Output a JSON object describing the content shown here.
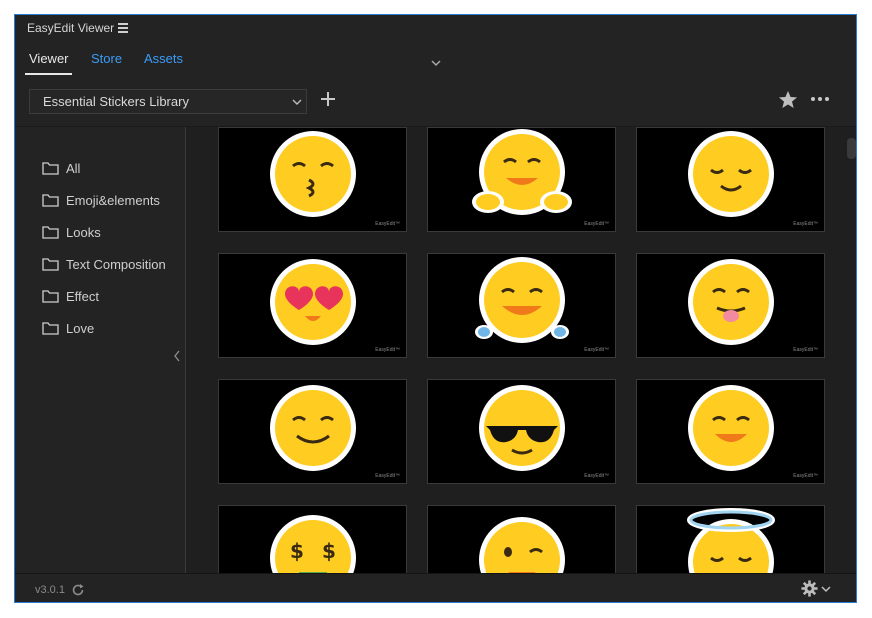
{
  "window": {
    "title": "EasyEdit Viewer"
  },
  "tabs": [
    {
      "label": "Viewer",
      "active": true
    },
    {
      "label": "Store",
      "active": false
    },
    {
      "label": "Assets",
      "active": false
    }
  ],
  "toolbar": {
    "library_select": "Essential Stickers Library"
  },
  "sidebar": {
    "items": [
      {
        "label": "All"
      },
      {
        "label": "Emoji&elements"
      },
      {
        "label": "Looks"
      },
      {
        "label": "Text Composition"
      },
      {
        "label": "Effect"
      },
      {
        "label": "Love"
      }
    ]
  },
  "grid": {
    "watermark": "EasyEdit™",
    "items": [
      {
        "icon": "kissing-face-icon"
      },
      {
        "icon": "hugging-face-icon"
      },
      {
        "icon": "relieved-face-icon"
      },
      {
        "icon": "heart-eyes-face-icon"
      },
      {
        "icon": "tears-of-joy-face-icon"
      },
      {
        "icon": "tongue-face-icon"
      },
      {
        "icon": "smiling-face-icon"
      },
      {
        "icon": "sunglasses-face-icon"
      },
      {
        "icon": "grinning-face-icon"
      },
      {
        "icon": "money-face-icon"
      },
      {
        "icon": "winking-face-icon"
      },
      {
        "icon": "halo-face-icon"
      }
    ]
  },
  "footer": {
    "version": "v3.0.1"
  },
  "colors": {
    "accent": "#2e7bd6",
    "link": "#3b9cf5",
    "panel": "#232323",
    "emoji": "#ffcc22"
  }
}
